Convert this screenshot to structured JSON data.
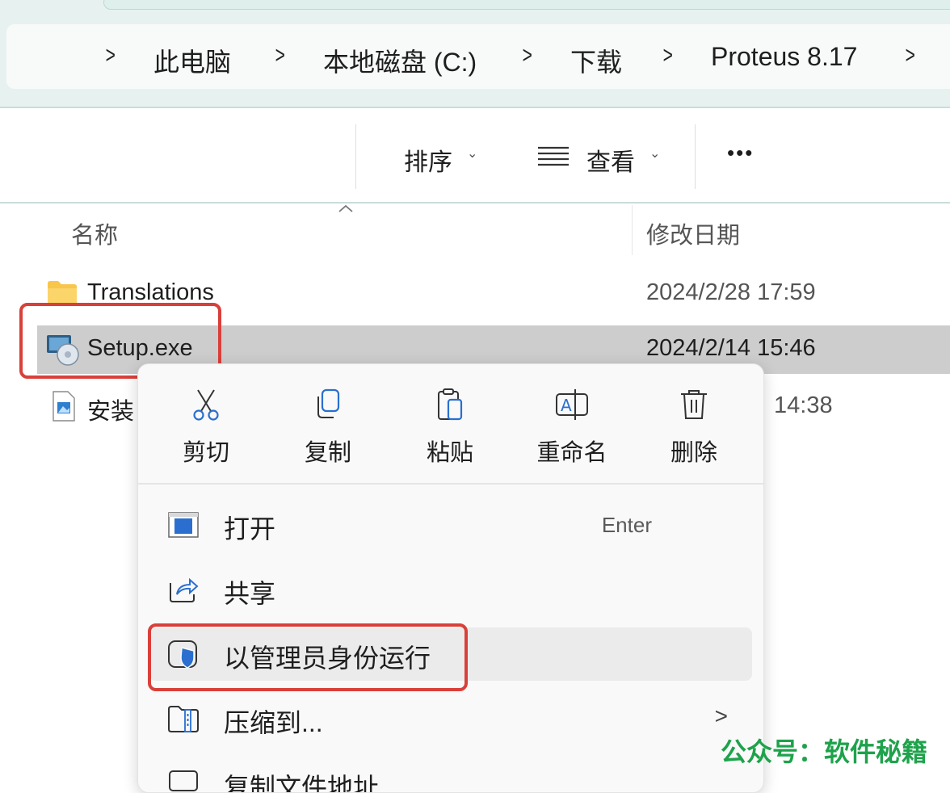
{
  "breadcrumb": {
    "items": [
      "此电脑",
      "本地磁盘 (C:)",
      "下载",
      "Proteus 8.17"
    ],
    "separator": ">"
  },
  "toolbar": {
    "sort_label": "排序",
    "view_label": "查看",
    "more_label": "•••",
    "caret": "⌄"
  },
  "file_list": {
    "columns": {
      "name": "名称",
      "modified": "修改日期"
    },
    "rows": [
      {
        "name": "Translations",
        "date": "2024/2/28 17:59",
        "type": "folder"
      },
      {
        "name": "Setup.exe",
        "date": "2024/2/14 15:46",
        "type": "exe",
        "selected": true
      },
      {
        "name": "安装",
        "date": "14:38",
        "type": "image"
      }
    ]
  },
  "context_menu": {
    "quick_actions": [
      {
        "label": "剪切",
        "icon": "scissors-icon"
      },
      {
        "label": "复制",
        "icon": "copy-icon"
      },
      {
        "label": "粘贴",
        "icon": "paste-icon"
      },
      {
        "label": "重命名",
        "icon": "rename-icon"
      },
      {
        "label": "删除",
        "icon": "trash-icon"
      }
    ],
    "items": [
      {
        "label": "打开",
        "accelerator": "Enter",
        "icon": "open-window-icon"
      },
      {
        "label": "共享",
        "icon": "share-icon"
      },
      {
        "label": "以管理员身份运行",
        "icon": "shield-icon",
        "highlighted": true
      },
      {
        "label": "压缩到...",
        "icon": "zip-folder-icon",
        "submenu_arrow": ">"
      },
      {
        "label": "复制文件地址",
        "icon": "copy-path-icon"
      }
    ]
  },
  "watermark": "公众号：软件秘籍",
  "colors": {
    "highlight_red": "#d9403a",
    "watermark_green": "#1ea24b",
    "header_bg": "#e7f2f0"
  }
}
